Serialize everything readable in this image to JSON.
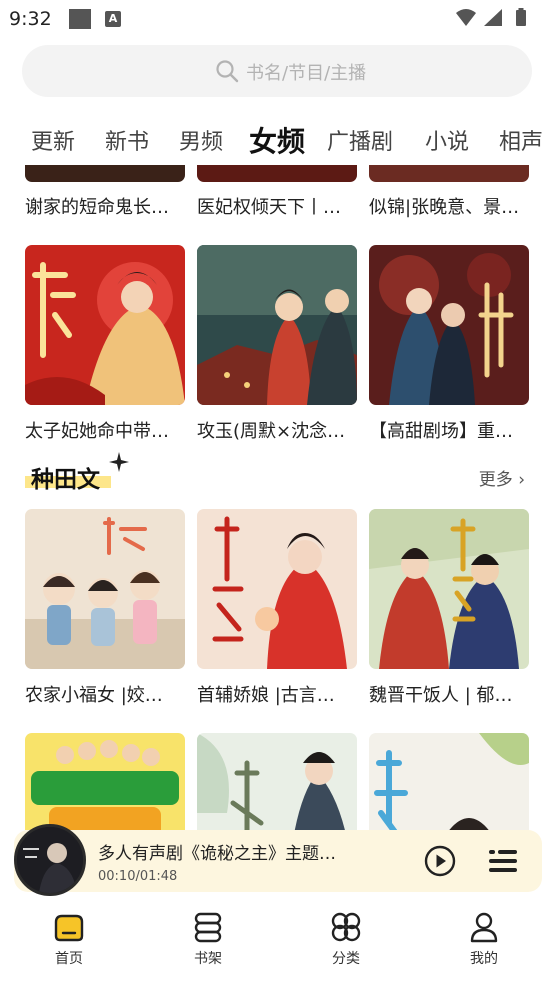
{
  "status_bar": {
    "time": "9:32",
    "a_badge": "A"
  },
  "search": {
    "placeholder": "书名/节目/主播"
  },
  "tabs": [
    {
      "label": "更新",
      "active": false
    },
    {
      "label": "新书",
      "active": false
    },
    {
      "label": "男频",
      "active": false
    },
    {
      "label": "女频",
      "active": true
    },
    {
      "label": "广播剧",
      "active": false
    },
    {
      "label": "小说",
      "active": false
    },
    {
      "label": "相声",
      "active": false
    }
  ],
  "row0": {
    "titles": [
      "谢家的短命鬼长…",
      "医妃权倾天下丨…",
      "似锦|张晚意、景…"
    ]
  },
  "row1": {
    "titles": [
      "太子妃她命中带…",
      "攻玉(周默×沈念…",
      "【高甜剧场】重…"
    ]
  },
  "section": {
    "title": "种田文",
    "more": "更多 ›"
  },
  "row2": {
    "titles": [
      "农家小福女 |姣…",
      "首辅娇娘 |古言…",
      "魏晋干饭人 | 郁…"
    ]
  },
  "player": {
    "title": "多人有声剧《诡秘之主》主题…",
    "time": "00:10/01:48"
  },
  "nav": [
    {
      "label": "首页",
      "icon": "home-icon",
      "active": true
    },
    {
      "label": "书架",
      "icon": "bookshelf-icon",
      "active": false
    },
    {
      "label": "分类",
      "icon": "category-icon",
      "active": false
    },
    {
      "label": "我的",
      "icon": "profile-icon",
      "active": false
    }
  ],
  "colors": {
    "accent": "#f6c428",
    "highlight": "#fde68a",
    "player_bg": "#fdf6df"
  }
}
